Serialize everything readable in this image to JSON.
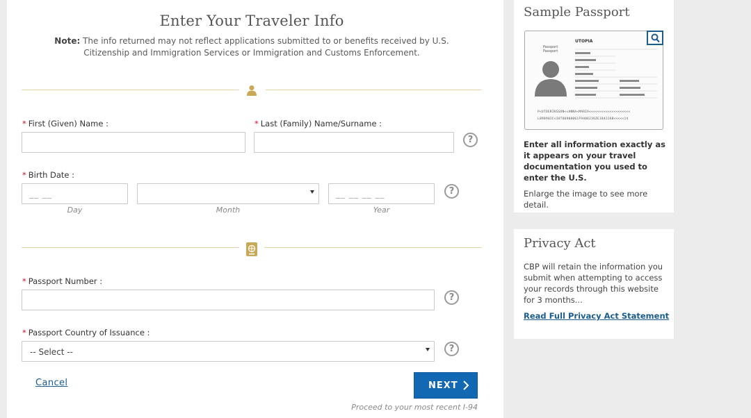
{
  "form": {
    "title": "Enter Your Traveler Info",
    "note_label": "Note:",
    "note_text": " The info returned may not reflect applications submitted to or benefits received by U.S. Citizenship and Immigration Services or Immigration and Customs Enforcement.",
    "required_marker": "*",
    "first_name_label": "First (Given) Name :",
    "last_name_label": "Last (Family) Name/Surname :",
    "birth_date_label": "Birth Date :",
    "day_placeholder": "__ __",
    "year_placeholder": "__ __ __ __",
    "day_caption": "Day",
    "month_caption": "Month",
    "year_caption": "Year",
    "passport_number_label": "Passport Number :",
    "passport_country_label": "Passport Country of Issuance :",
    "country_select_value": "-- Select --",
    "help_glyph": "?",
    "cancel_label": "Cancel",
    "next_label": "NEXT",
    "proceed_text": "Proceed to your most recent I-94"
  },
  "sidebar": {
    "sample_title": "Sample Passport",
    "sample_bold_text": "Enter all information exactly as it appears on your travel documentation you used to enter the U.S.",
    "sample_text": "Enlarge the image to see more detail.",
    "passport": {
      "doc_label_1": "Passport",
      "doc_label_2": "Passport",
      "country": "UTOPIA",
      "mrz_line_1": "P<UTOERIKSSON<<ANNA<MARIA<<<<<<<<<<<<<<<<<<<<",
      "mrz_line_2": "L898902C<3UTO6908061F9406236ZE184226B<<<<<14"
    },
    "privacy_title": "Privacy Act",
    "privacy_text": "CBP will retain the information you submit when attempting to access your records through this website for 3 months...",
    "privacy_link": "Read Full Privacy Act Statement"
  },
  "icons": {
    "person_divider": "person-icon",
    "passport_divider": "passport-icon",
    "help": "question-circle-icon",
    "zoom": "search-icon",
    "next": "chevron-right-icon"
  },
  "colors": {
    "accent_gold": "#c9a857",
    "divider_gold": "#e6d3a6",
    "primary_blue": "#1368b3",
    "link_blue": "#1a5c8c",
    "required_red": "#c8102e"
  }
}
